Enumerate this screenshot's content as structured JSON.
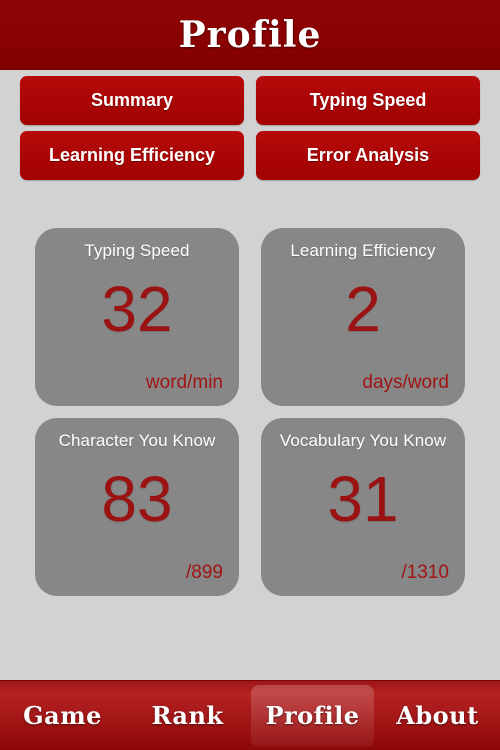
{
  "header": {
    "title": "Profile"
  },
  "nav_buttons": [
    {
      "label": "Summary"
    },
    {
      "label": "Typing Speed"
    },
    {
      "label": "Learning Efficiency"
    },
    {
      "label": "Error Analysis"
    }
  ],
  "stat_cards": [
    {
      "title": "Typing Speed",
      "value": "32",
      "unit": "word/min"
    },
    {
      "title": "Learning Efficiency",
      "value": "2",
      "unit": "days/word"
    },
    {
      "title": "Character You Know",
      "value": "83",
      "unit": "/899"
    },
    {
      "title": "Vocabulary You Know",
      "value": "31",
      "unit": "/1310"
    }
  ],
  "tabbar": {
    "active": "Profile",
    "tabs": [
      {
        "label": "Game"
      },
      {
        "label": "Rank"
      },
      {
        "label": "Profile"
      },
      {
        "label": "About"
      }
    ]
  },
  "colors": {
    "header_red": "#8a0202",
    "button_red": "#ab0606",
    "card_gray": "#878787",
    "value_red": "#9b1212",
    "background_gray": "#d2d2d2",
    "tabbar_red": "#9d1111"
  }
}
